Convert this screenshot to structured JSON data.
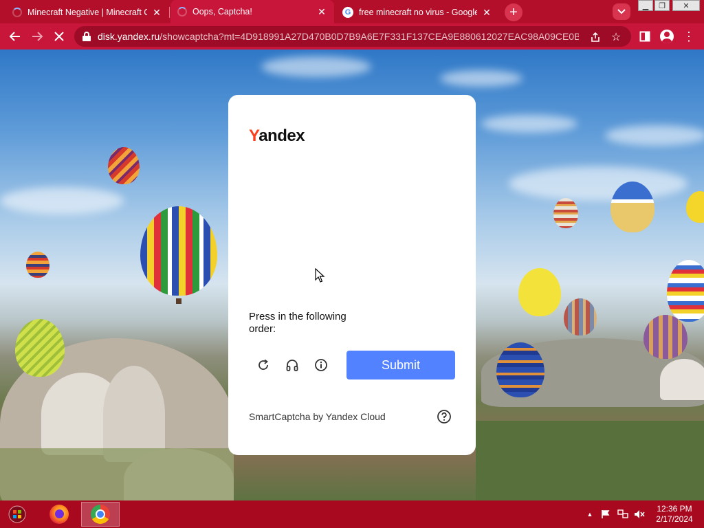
{
  "browser": {
    "tabs": [
      {
        "title": "Minecraft Negative | Minecraft C",
        "favicon": "loading-spinner",
        "close": "✕"
      },
      {
        "title": "Oops, Captcha!",
        "favicon": "loading-spinner",
        "close": "✕"
      },
      {
        "title": "free minecraft no virus - Google",
        "favicon": "google-icon",
        "close": "✕"
      }
    ],
    "new_tab": "+",
    "url_host": "disk.yandex.ru",
    "url_rest": "/showcaptcha?mt=4D918991A27D470B0D7B9A6E7F331F137CEA9E880612027EAC98A09CE0B8A4...",
    "theme_color": "#c8163a"
  },
  "captcha": {
    "logo_first": "Y",
    "logo_rest": "andex",
    "instruction": "Press in the following order:",
    "submit_label": "Submit",
    "footer": "SmartCaptcha by Yandex Cloud",
    "submit_color": "#5282ff",
    "logo_color": "#fc3f1d"
  },
  "taskbar": {
    "time": "12:36 PM",
    "date": "2/17/2024",
    "apps": [
      "firefox",
      "chrome"
    ]
  }
}
